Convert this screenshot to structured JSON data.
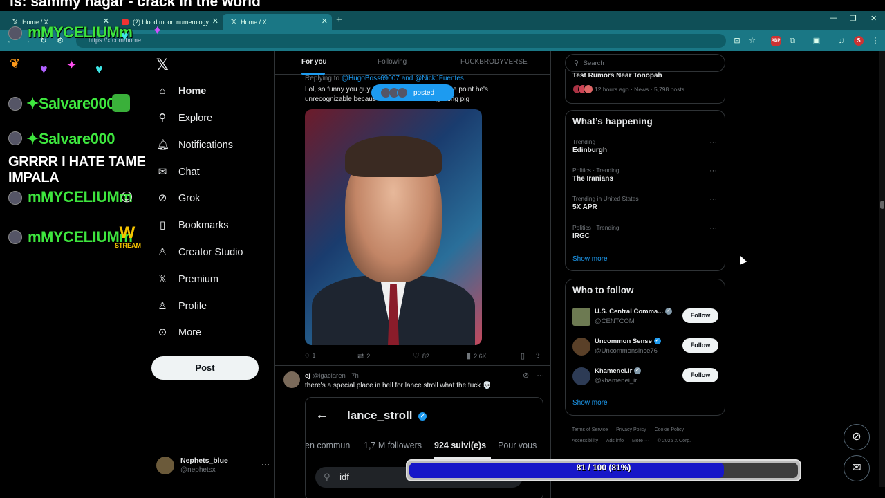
{
  "stream_banner": "is: sammy hagar - crack in the world",
  "browser": {
    "tabs": [
      {
        "title": "Home / X",
        "favicon": "x-logo"
      },
      {
        "title": "(2) blood moon numerology",
        "favicon": "youtube-icon"
      },
      {
        "title": "Home / X",
        "favicon": "x-logo"
      }
    ],
    "url": "https://x.com/home",
    "profile_initial": "S"
  },
  "chat": {
    "lines": [
      {
        "user": "mMYCELIUMm"
      },
      {
        "user": "Salvare000"
      },
      {
        "user": "Salvare000"
      },
      {
        "message": "GRRRR I HATE TAME IMPALA"
      },
      {
        "user": "mMYCELIUMm"
      },
      {
        "user": "mMYCELIUMm"
      }
    ],
    "stream_emote_text": "STREAM",
    "stream_emote_letter": "W"
  },
  "nav": {
    "items": [
      {
        "label": "Home",
        "icon": "home-icon"
      },
      {
        "label": "Explore",
        "icon": "search-icon"
      },
      {
        "label": "Notifications",
        "icon": "bell-icon"
      },
      {
        "label": "Chat",
        "icon": "mail-icon"
      },
      {
        "label": "Grok",
        "icon": "grok-icon"
      },
      {
        "label": "Bookmarks",
        "icon": "bookmark-icon"
      },
      {
        "label": "Creator Studio",
        "icon": "creator-icon"
      },
      {
        "label": "Premium",
        "icon": "x-icon"
      },
      {
        "label": "Profile",
        "icon": "person-icon"
      },
      {
        "label": "More",
        "icon": "more-icon"
      }
    ],
    "post_label": "Post",
    "account": {
      "name": "Nephets_blue",
      "handle": "@nephetsx"
    }
  },
  "feed": {
    "tabs": [
      "For you",
      "Following",
      "FUCKBRODYVERSE"
    ],
    "active_tab": "For you",
    "posted_pill": "posted",
    "tweet1": {
      "replying_prefix": "Replying to",
      "mentions": "@HugoBoss69007 and @NickJFuentes",
      "line1": "Lol, so funny you guy",
      "line1_end": "ce to the point he's",
      "line2": "unrecognizable becaus",
      "line2_end": "gusting pig",
      "replies": "1",
      "reposts": "2",
      "likes": "82",
      "views": "2.6K"
    },
    "tweet2": {
      "name": "ej",
      "handle": "@lgaclaren",
      "time": "7h",
      "text": "there's a special place in hell for lance stroll what the fuck 💀",
      "embed": {
        "username": "lance_stroll",
        "stats": [
          "en commun",
          "1,7 M followers",
          "924 suivi(e)s",
          "Pour vous"
        ],
        "active_stat": "924 suivi(e)s",
        "search_value": "idf"
      }
    }
  },
  "sidebar": {
    "search_placeholder": "Search",
    "top_trend": {
      "title": "Test Rumors Near Tonopah",
      "meta": "12 hours ago · News · 5,798 posts"
    },
    "whats_happening": {
      "title": "What’s happening",
      "trends": [
        {
          "category": "Trending",
          "name": "Edinburgh"
        },
        {
          "category": "Politics · Trending",
          "name": "The Iranians"
        },
        {
          "category": "Trending in United States",
          "name": "5X APR"
        },
        {
          "category": "Politics · Trending",
          "name": "IRGC"
        }
      ],
      "show_more": "Show more"
    },
    "who_to_follow": {
      "title": "Who to follow",
      "accounts": [
        {
          "name": "U.S. Central Comma...",
          "handle": "@CENTCOM",
          "verified": "grey"
        },
        {
          "name": "Uncommon Sense",
          "handle": "@Uncommonsince76",
          "verified": "blue"
        },
        {
          "name": "Khamenei.ir",
          "handle": "@khamenei_ir",
          "verified": "grey"
        }
      ],
      "follow_label": "Follow",
      "show_more": "Show more"
    },
    "footer": [
      "Terms of Service",
      "Privacy Policy",
      "Cookie Policy",
      "Accessibility",
      "Ads info",
      "More ···",
      "© 2026 X Corp."
    ]
  },
  "progress": {
    "label": "81 / 100 (81%)",
    "fraction": 0.81
  },
  "colors": {
    "accent": "#1d9bf0",
    "chrome": "#1a7785",
    "progress_fill": "#1717c8"
  }
}
